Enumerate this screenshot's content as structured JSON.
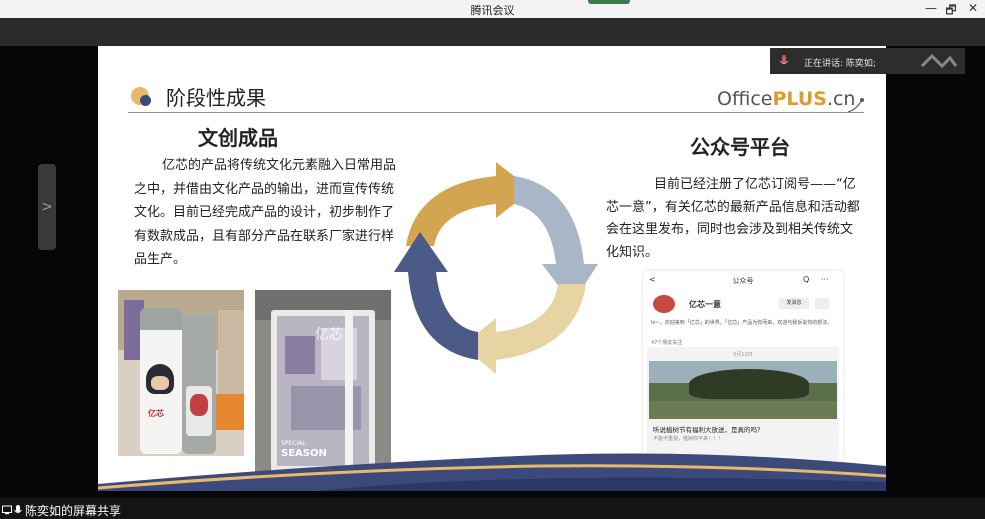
{
  "window": {
    "title": "腾讯会议",
    "minimize": "—",
    "restore": "🗗",
    "close": "✕"
  },
  "speaker": {
    "label": "正在讲话: 陈奕如;"
  },
  "share": {
    "label": "陈奕如的屏幕共享"
  },
  "sidebar": {
    "expand_arrow": ">"
  },
  "slide": {
    "title": "阶段性成果",
    "brand_prefix": "Office",
    "brand_bold": "PLUS",
    "brand_suffix": ".cn",
    "left_heading": "文创成品",
    "left_body": "亿芯的产品将传统文化元素融入日常用品之中，并借由文化产品的输出，进而宣传传统文化。目前已经完成产品的设计，初步制作了有数款成品，且有部分产品在联系厂家进行样品生产。",
    "right_heading": "公众号平台",
    "right_body": "目前已经注册了亿芯订阅号——“亿芯一意”，有关亿芯的最新产品信息和活动都会在这里发布，同时也会涉及到相关传统文化知识。",
    "photo1_text": "亿芯",
    "photo2_text_a": "亿芯",
    "photo2_text_b": "SPECIAL",
    "photo2_text_c": "SEASON",
    "phone": {
      "back": "<",
      "header": "公众号",
      "search": "Q",
      "more": "···",
      "account_name": "亿芯一意",
      "message_btn": "发消息",
      "intro": "hi~，欢迎来到「亿芯」的世界。「亿芯」产品为你而来，欢迎与我诉说你的想法。",
      "followers": "47个朋友关注",
      "date": "5月12日",
      "article_title": "听说植树节有福利大放送，是真的吗？",
      "article_sub": "不能不重视，植树你不来！！！"
    }
  },
  "colors": {
    "arrow_gold": "#d4a550",
    "arrow_gray": "#a9b6c8",
    "arrow_sand": "#e8d3a3",
    "arrow_navy": "#4b5a86",
    "brand_accent": "#e39a2c"
  }
}
